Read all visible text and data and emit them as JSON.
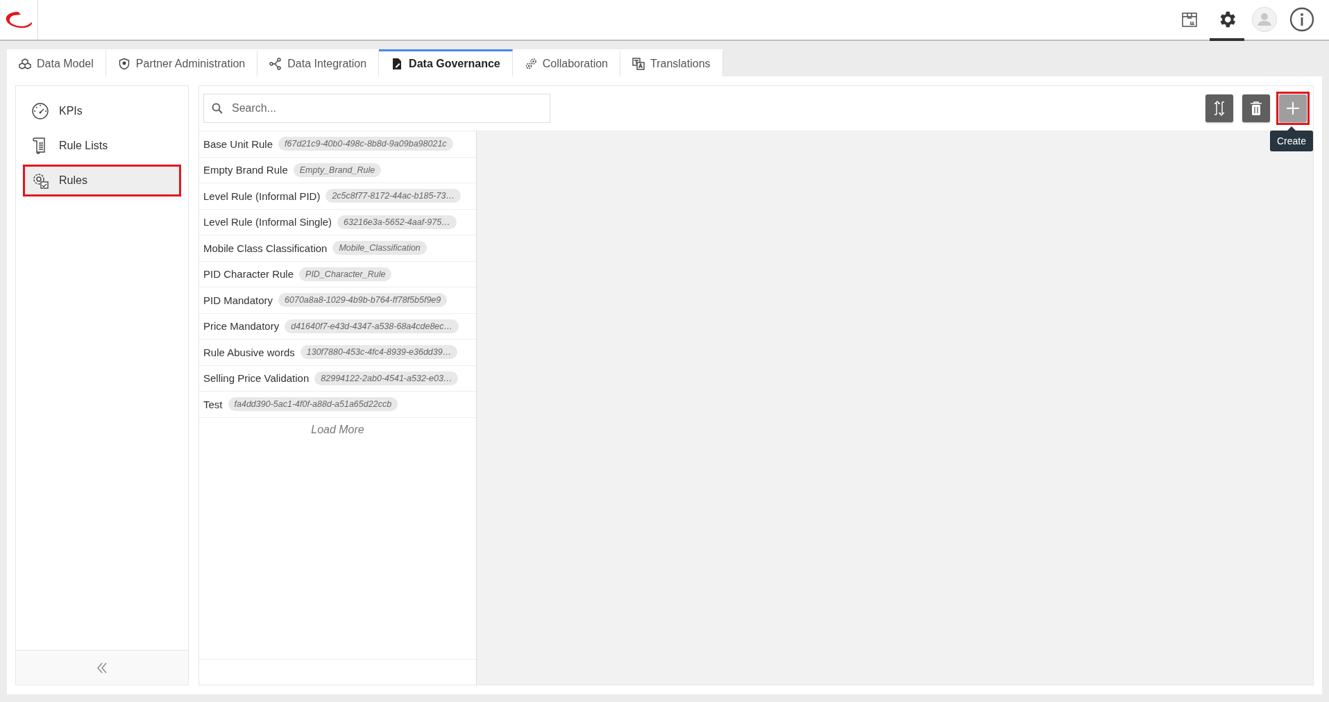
{
  "top_bar": {
    "icons": [
      {
        "kind": "package",
        "selected": false
      },
      {
        "kind": "settings",
        "selected": true
      },
      {
        "kind": "avatar",
        "selected": false
      },
      {
        "kind": "info",
        "selected": false
      }
    ]
  },
  "tabs": [
    {
      "label": "Data Model",
      "kind": "cubes",
      "selected": false
    },
    {
      "label": "Partner Administration",
      "kind": "shield",
      "selected": false
    },
    {
      "label": "Data Integration",
      "kind": "nodes",
      "selected": false
    },
    {
      "label": "Data Governance",
      "kind": "document",
      "selected": true
    },
    {
      "label": "Collaboration",
      "kind": "gears",
      "selected": false
    },
    {
      "label": "Translations",
      "kind": "translate",
      "selected": false
    }
  ],
  "sidebar": {
    "items": [
      {
        "label": "KPIs",
        "kind": "gauge",
        "selected": false,
        "highlighted": false
      },
      {
        "label": "Rule Lists",
        "kind": "scroll",
        "selected": false,
        "highlighted": false
      },
      {
        "label": "Rules",
        "kind": "gear",
        "selected": true,
        "highlighted": true
      }
    ]
  },
  "toolbar": {
    "search": {
      "placeholder": "Search..."
    },
    "buttons": [
      {
        "kind": "sync",
        "hovered": false,
        "highlighted": false
      },
      {
        "kind": "delete",
        "hovered": false,
        "highlighted": false
      },
      {
        "kind": "create",
        "hovered": true,
        "highlighted": true,
        "tooltip": "Create"
      }
    ]
  },
  "rules": [
    {
      "name": "Base Unit Rule",
      "id": "f67d21c9-40b0-498c-8b8d-9a09ba98021c"
    },
    {
      "name": "Empty Brand Rule",
      "id": "Empty_Brand_Rule"
    },
    {
      "name": "Level Rule (Informal PID)",
      "id": "2c5c8f77-8172-44ac-b185-73…"
    },
    {
      "name": "Level Rule (Informal Single)",
      "id": "63216e3a-5652-4aaf-975…"
    },
    {
      "name": "Mobile Class Classification",
      "id": "Mobile_Classification"
    },
    {
      "name": "PID Character Rule",
      "id": "PID_Character_Rule"
    },
    {
      "name": "PID Mandatory",
      "id": "6070a8a8-1029-4b9b-b764-ff78f5b5f9e9"
    },
    {
      "name": "Price Mandatory",
      "id": "d41640f7-e43d-4347-a538-68a4cde8ec…"
    },
    {
      "name": "Rule Abusive words",
      "id": "130f7880-453c-4fc4-8939-e36dd39…"
    },
    {
      "name": "Selling Price Validation",
      "id": "82994122-2ab0-4541-a532-e03…"
    },
    {
      "name": "Test",
      "id": "fa4dd390-5ac1-4f0f-a88d-a51a65d22ccb"
    }
  ],
  "load_more": "Load More"
}
